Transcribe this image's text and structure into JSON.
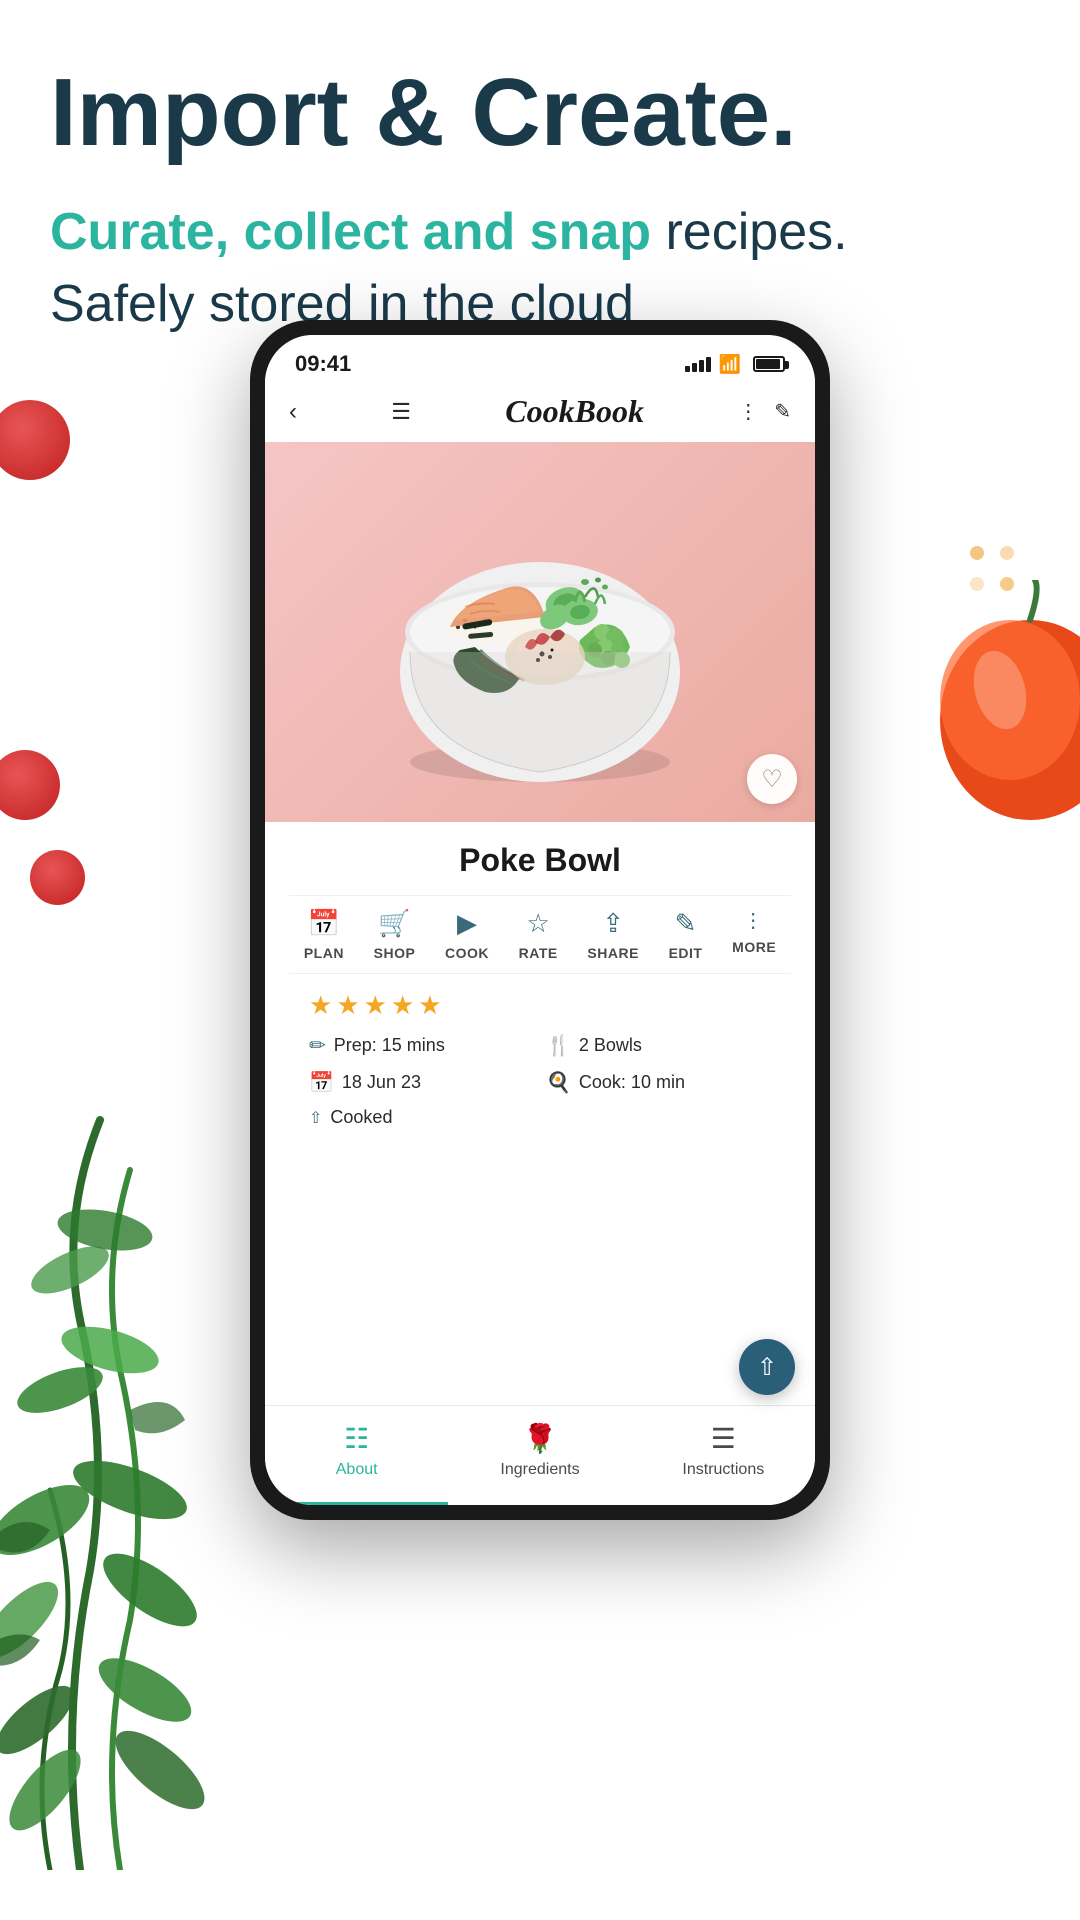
{
  "page": {
    "background": "#ffffff"
  },
  "header": {
    "main_title": "Import & Create.",
    "subtitle_highlight": "Curate, collect and snap",
    "subtitle_rest": " recipes.",
    "subtitle_line2": "Safely stored in the cloud"
  },
  "phone": {
    "status_bar": {
      "time": "09:41"
    },
    "app_name": "CookBook",
    "recipe": {
      "name": "Poke Bowl",
      "stars": 5,
      "servings": "2 Bowls",
      "prep": "Prep: 15 mins",
      "cook": "Cook: 10 min",
      "date": "18 Jun 23",
      "cooked": "Cooked"
    },
    "actions": {
      "plan": "PLAN",
      "shop": "SHOP",
      "cook": "COOK",
      "rate": "RATE",
      "share": "SHARE",
      "edit": "EDIT",
      "more": "MORE"
    },
    "bottom_nav": {
      "about": "About",
      "ingredients": "Ingredients",
      "instructions": "Instructions"
    }
  }
}
